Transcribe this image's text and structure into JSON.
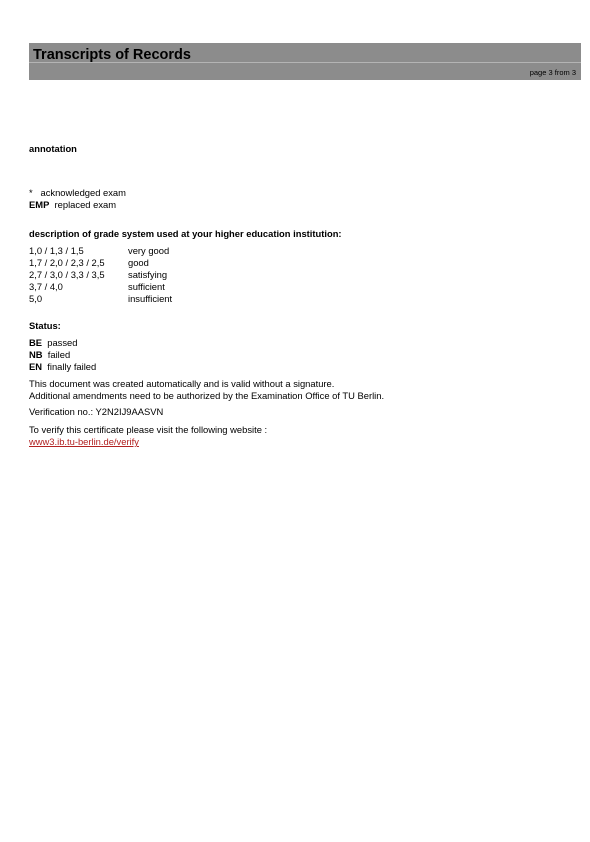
{
  "header": {
    "title": "Transcripts of Records",
    "page_info": "page 3 from 3"
  },
  "annotation": {
    "heading": "annotation",
    "items": [
      {
        "key": "*",
        "text": "acknowledged exam"
      },
      {
        "key": "EMP",
        "text": "replaced exam"
      }
    ]
  },
  "grade_system": {
    "heading": "description of grade system used at your higher education institution:",
    "rows": [
      {
        "grades": "1,0 / 1,3 / 1,5",
        "description": "very good"
      },
      {
        "grades": "1,7 / 2,0 / 2,3 / 2,5",
        "description": "good"
      },
      {
        "grades": "2,7 / 3,0 / 3,3 / 3,5",
        "description": "satisfying"
      },
      {
        "grades": "3,7 / 4,0",
        "description": "sufficient"
      },
      {
        "grades": "5,0",
        "description": "insufficient"
      }
    ]
  },
  "status": {
    "heading": "Status:",
    "items": [
      {
        "key": "BE",
        "text": "passed"
      },
      {
        "key": "NB",
        "text": "failed"
      },
      {
        "key": "EN",
        "text": "finally failed"
      }
    ]
  },
  "notice": {
    "line1": "This document was created automatically and is valid without a signature.",
    "line2": "Additional amendments need to be authorized by the Examination Office of TU Berlin."
  },
  "verification": {
    "text": "Verification no.: Y2N2IJ9AASVN"
  },
  "verify_site": {
    "text": "To verify this certificate please visit the following website :",
    "link": "www3.ib.tu-berlin.de/verify",
    "link_color": "#b22222"
  }
}
